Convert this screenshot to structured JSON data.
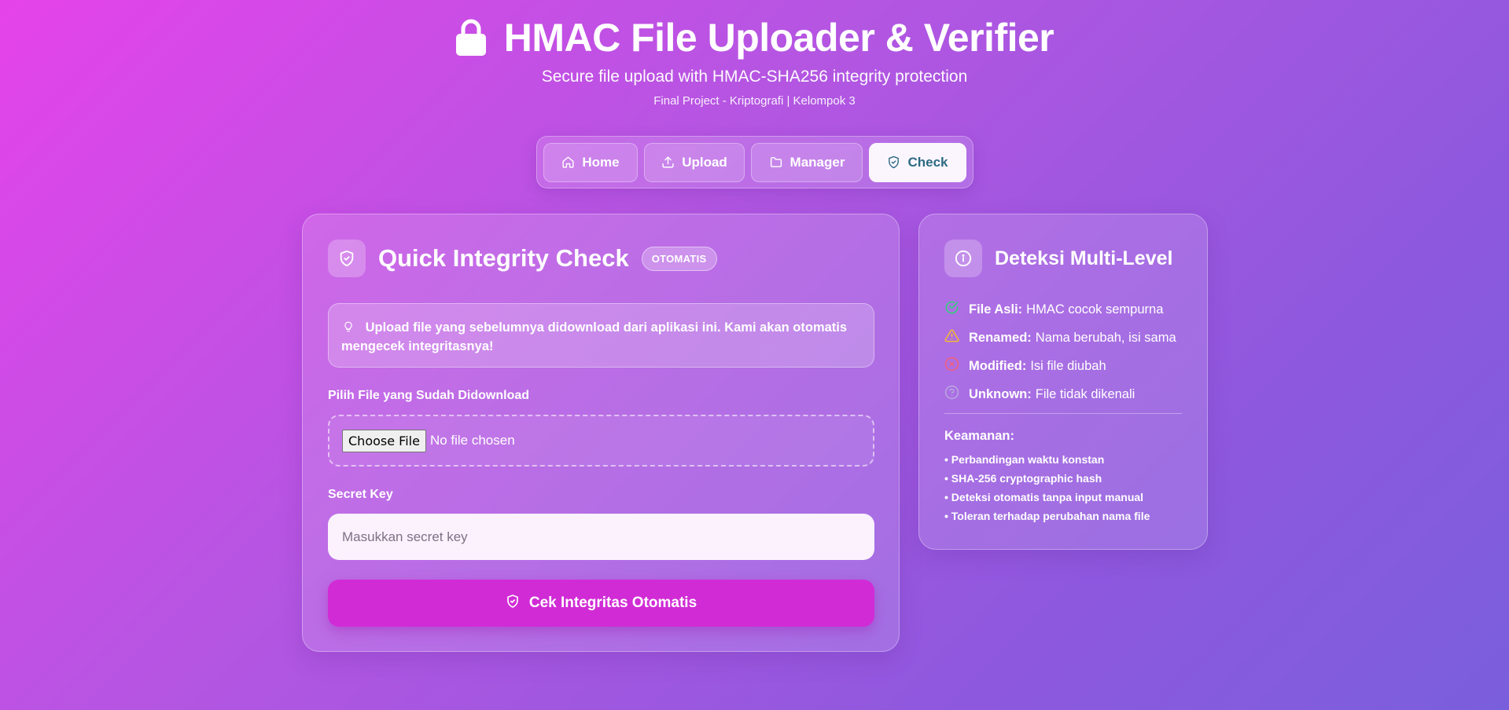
{
  "header": {
    "title": "HMAC File Uploader & Verifier",
    "subtitle": "Secure file upload with HMAC-SHA256 integrity protection",
    "meta": "Final Project - Kriptografi | Kelompok 3",
    "icon": "lock-icon"
  },
  "nav": {
    "items": [
      {
        "label": "Home",
        "icon": "home-icon",
        "active": false
      },
      {
        "label": "Upload",
        "icon": "upload-icon",
        "active": false
      },
      {
        "label": "Manager",
        "icon": "folder-icon",
        "active": false
      },
      {
        "label": "Check",
        "icon": "shield-check-icon",
        "active": true
      }
    ]
  },
  "main": {
    "title": "Quick Integrity Check",
    "badge": "OTOMATIS",
    "info": "Upload file yang sebelumnya didownload dari aplikasi ini. Kami akan otomatis mengecek integritasnya!",
    "file_label": "Pilih File yang Sudah Didownload",
    "file_button": "Choose File",
    "file_status": "No file chosen",
    "key_label": "Secret Key",
    "key_value": "",
    "key_placeholder": "Masukkan secret key",
    "submit_label": "Cek Integritas Otomatis"
  },
  "side": {
    "title": "Deteksi Multi-Level",
    "detections": [
      {
        "label": "File Asli:",
        "text": "HMAC cocok sempurna",
        "icon": "check-circle-icon",
        "color": "#2fd27a"
      },
      {
        "label": "Renamed:",
        "text": "Nama berubah, isi sama",
        "icon": "warning-icon",
        "color": "#f5b731"
      },
      {
        "label": "Modified:",
        "text": "Isi file diubah",
        "icon": "x-circle-icon",
        "color": "#f0607c"
      },
      {
        "label": "Unknown:",
        "text": "File tidak dikenali",
        "icon": "question-circle-icon",
        "color": "#b9a5e0"
      }
    ],
    "security_title": "Keamanan:",
    "security_items": [
      "• Perbandingan waktu konstan",
      "• SHA-256 cryptographic hash",
      "• Deteksi otomatis tanpa input manual",
      "• Toleran terhadap perubahan nama file"
    ]
  },
  "colors": {
    "bg_start": "#e543ea",
    "bg_end": "#7a5fdc",
    "accent_button": "#d12bd6",
    "active_tab_text": "#2d6a83"
  }
}
